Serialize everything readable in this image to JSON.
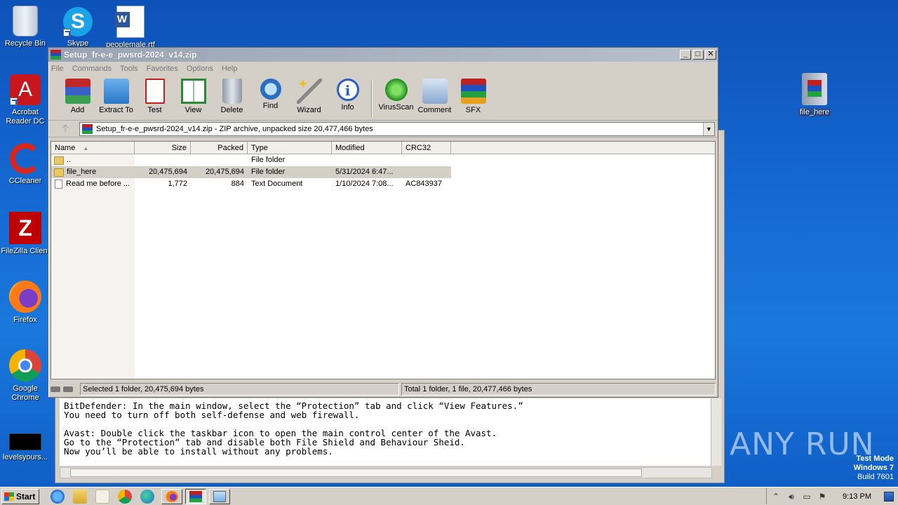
{
  "desktop": {
    "icons": [
      {
        "label": "Recycle Bin",
        "icon": "recycle-bin-icon"
      },
      {
        "label": "Skype",
        "icon": "skype-icon"
      },
      {
        "label": "peoplemale.rtf",
        "icon": "word-document-icon"
      },
      {
        "label": "Acrobat Reader DC",
        "icon": "acrobat-reader-icon"
      },
      {
        "label": "CCleaner",
        "icon": "ccleaner-icon"
      },
      {
        "label": "FileZilla Client",
        "icon": "filezilla-icon"
      },
      {
        "label": "Firefox",
        "icon": "firefox-icon"
      },
      {
        "label": "Google Chrome",
        "icon": "chrome-icon"
      },
      {
        "label": "levelsyours...",
        "icon": "black-file-icon"
      },
      {
        "label": "file_here",
        "icon": "winrar-archive-icon"
      }
    ],
    "watermark": "ANY RUN",
    "test_mode": {
      "line1": "Test Mode",
      "line2": "Windows 7",
      "line3": "Build 7601"
    }
  },
  "bg_document": {
    "lines": "BitDefender: In the main window, select the “Protection” tab and click “View Features.”\nYou need to turn off both self-defense and web firewall.\n\nAvast: Double click the taskbar icon to open the main control center of the Avast.\nGo to the “Protection” tab and disable both File Shield and Behaviour Sheid.\nNow you’ll be able to install without any problems."
  },
  "winrar": {
    "title": "Setup_fr-e-e_pwsrd-2024_v14.zip",
    "menu": [
      "File",
      "Commands",
      "Tools",
      "Favorites",
      "Options",
      "Help"
    ],
    "toolbar": [
      {
        "label": "Add",
        "icon": "add-archive-icon"
      },
      {
        "label": "Extract To",
        "icon": "extract-folder-icon"
      },
      {
        "label": "Test",
        "icon": "test-clipboard-icon"
      },
      {
        "label": "View",
        "icon": "view-book-icon"
      },
      {
        "label": "Delete",
        "icon": "trash-icon"
      },
      {
        "label": "Find",
        "icon": "magnifier-icon"
      },
      {
        "label": "Wizard",
        "icon": "wizard-wand-icon"
      },
      {
        "label": "Info",
        "icon": "info-icon"
      },
      {
        "label": "VirusScan",
        "icon": "virus-scan-icon"
      },
      {
        "label": "Comment",
        "icon": "comment-icon"
      },
      {
        "label": "SFX",
        "icon": "sfx-icon"
      }
    ],
    "address": "Setup_fr-e-e_pwsrd-2024_v14.zip - ZIP archive, unpacked size 20,477,466 bytes",
    "columns": {
      "name": "Name",
      "size": "Size",
      "packed": "Packed",
      "type": "Type",
      "modified": "Modified",
      "crc": "CRC32"
    },
    "rows": [
      {
        "name": "..",
        "size": "",
        "packed": "",
        "type": "File folder",
        "modified": "",
        "crc": "",
        "icon": "folder"
      },
      {
        "name": "file_here",
        "size": "20,475,694",
        "packed": "20,475,694",
        "type": "File folder",
        "modified": "5/31/2024 6:47...",
        "crc": "",
        "icon": "folder"
      },
      {
        "name": "Read me before ...",
        "size": "1,772",
        "packed": "884",
        "type": "Text Document",
        "modified": "1/10/2024 7:08...",
        "crc": "AC843937",
        "icon": "doc"
      }
    ],
    "status_left": "Selected 1 folder, 20,475,694 bytes",
    "status_right": "Total 1 folder, 1 file, 20,477,466 bytes"
  },
  "taskbar": {
    "start": "Start",
    "clock": "9:13 PM"
  }
}
